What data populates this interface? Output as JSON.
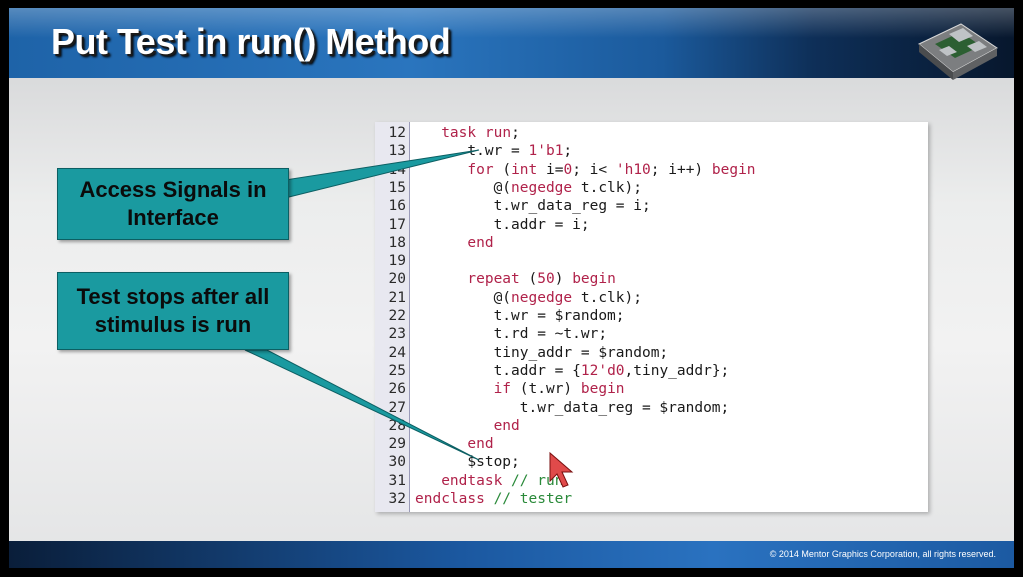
{
  "slide": {
    "title": "Put Test in run() Method",
    "callouts": [
      {
        "id": "access",
        "text": "Access Signals in Interface"
      },
      {
        "id": "stops",
        "text": "Test stops after all stimulus is run"
      }
    ],
    "copyright": "© 2014 Mentor Graphics Corporation, all rights reserved."
  },
  "code": {
    "line_numbers": [
      "12",
      "13",
      "14",
      "15",
      "16",
      "17",
      "18",
      "19",
      "20",
      "21",
      "22",
      "23",
      "24",
      "25",
      "26",
      "27",
      "28",
      "29",
      "30",
      "31",
      "32"
    ],
    "lines": [
      [
        {
          "t": "   "
        },
        {
          "t": "task",
          "c": "kw"
        },
        {
          "t": " "
        },
        {
          "t": "run",
          "c": "kw"
        },
        {
          "t": ";"
        }
      ],
      [
        {
          "t": "      t.wr = "
        },
        {
          "t": "1'b1",
          "c": "num"
        },
        {
          "t": ";"
        }
      ],
      [
        {
          "t": "      "
        },
        {
          "t": "for",
          "c": "kw"
        },
        {
          "t": " ("
        },
        {
          "t": "int",
          "c": "kw"
        },
        {
          "t": " i="
        },
        {
          "t": "0",
          "c": "num"
        },
        {
          "t": "; i< "
        },
        {
          "t": "'h10",
          "c": "num"
        },
        {
          "t": "; i++) "
        },
        {
          "t": "begin",
          "c": "kw"
        }
      ],
      [
        {
          "t": "         @("
        },
        {
          "t": "negedge",
          "c": "kw"
        },
        {
          "t": " t.clk);"
        }
      ],
      [
        {
          "t": "         t.wr_data_reg = i;"
        }
      ],
      [
        {
          "t": "         t.addr = i;"
        }
      ],
      [
        {
          "t": "      "
        },
        {
          "t": "end",
          "c": "kw"
        }
      ],
      [
        {
          "t": ""
        }
      ],
      [
        {
          "t": "      "
        },
        {
          "t": "repeat",
          "c": "kw"
        },
        {
          "t": " ("
        },
        {
          "t": "50",
          "c": "num"
        },
        {
          "t": ") "
        },
        {
          "t": "begin",
          "c": "kw"
        }
      ],
      [
        {
          "t": "         @("
        },
        {
          "t": "negedge",
          "c": "kw"
        },
        {
          "t": " t.clk);"
        }
      ],
      [
        {
          "t": "         t.wr = $random;"
        }
      ],
      [
        {
          "t": "         t.rd = ~t.wr;"
        }
      ],
      [
        {
          "t": "         tiny_addr = $random;"
        }
      ],
      [
        {
          "t": "         t.addr = {"
        },
        {
          "t": "12'd0",
          "c": "num"
        },
        {
          "t": ",tiny_addr};"
        }
      ],
      [
        {
          "t": "         "
        },
        {
          "t": "if",
          "c": "kw"
        },
        {
          "t": " (t.wr) "
        },
        {
          "t": "begin",
          "c": "kw"
        }
      ],
      [
        {
          "t": "            t.wr_data_reg = $random;"
        }
      ],
      [
        {
          "t": "         "
        },
        {
          "t": "end",
          "c": "kw"
        }
      ],
      [
        {
          "t": "      "
        },
        {
          "t": "end",
          "c": "kw"
        }
      ],
      [
        {
          "t": "      $stop;"
        }
      ],
      [
        {
          "t": "   "
        },
        {
          "t": "endtask",
          "c": "kw"
        },
        {
          "t": " "
        },
        {
          "t": "// run",
          "c": "cm"
        }
      ],
      [
        {
          "t": "endclass",
          "c": "kw"
        },
        {
          "t": " "
        },
        {
          "t": "// tester",
          "c": "cm"
        }
      ]
    ]
  },
  "colors": {
    "callout": "#1a9aa0",
    "keyword": "#b0224a",
    "comment": "#2a8a3a",
    "header": "#1e63a8"
  },
  "icons": [
    "chip-logo-icon",
    "mouse-cursor-icon"
  ]
}
